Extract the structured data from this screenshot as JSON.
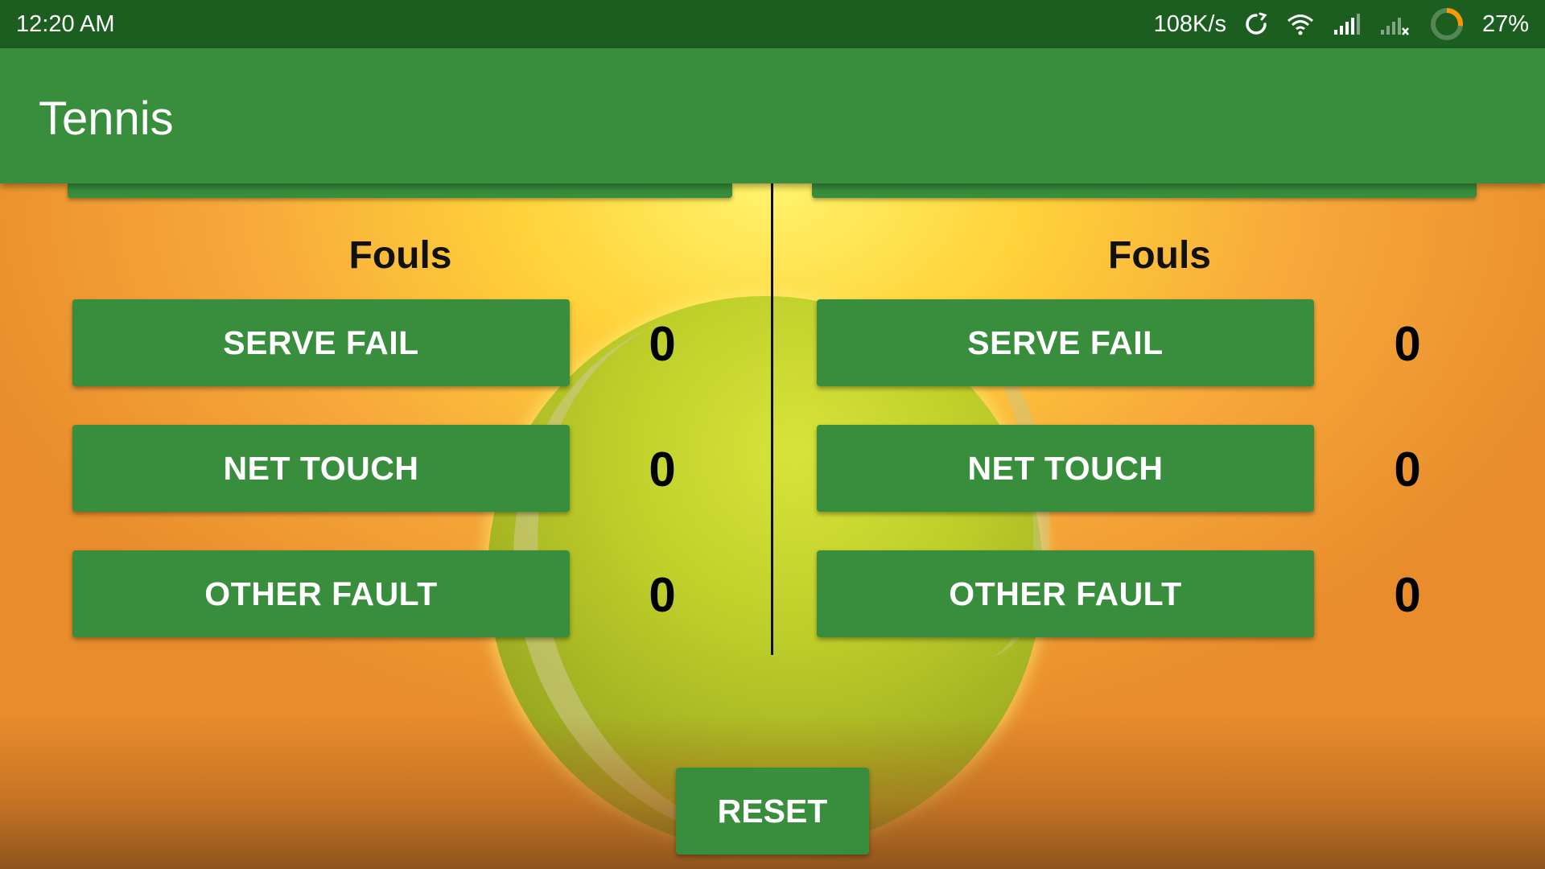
{
  "status_bar": {
    "time": "12:20 AM",
    "network_speed": "108K/s",
    "battery_percent": "27%",
    "battery_level": 0.27,
    "icons": [
      "sync-icon",
      "wifi-icon",
      "signal-icon",
      "signal-no-service-icon",
      "battery-ring-icon"
    ]
  },
  "app_bar": {
    "title": "Tennis"
  },
  "team_a": {
    "fouls_title": "Fouls",
    "fouls": [
      {
        "label": "SERVE FAIL",
        "count": "0"
      },
      {
        "label": "NET TOUCH",
        "count": "0"
      },
      {
        "label": "OTHER FAULT",
        "count": "0"
      }
    ]
  },
  "team_b": {
    "fouls_title": "Fouls",
    "fouls": [
      {
        "label": "SERVE FAIL",
        "count": "0"
      },
      {
        "label": "NET TOUCH",
        "count": "0"
      },
      {
        "label": "OTHER FAULT",
        "count": "0"
      }
    ]
  },
  "reset": {
    "label": "RESET"
  },
  "colors": {
    "status_bar": "#1b5e20",
    "primary": "#388e3c",
    "button_text": "#ffffff",
    "text_dark": "#111111",
    "battery_ring": "#ff9800"
  }
}
